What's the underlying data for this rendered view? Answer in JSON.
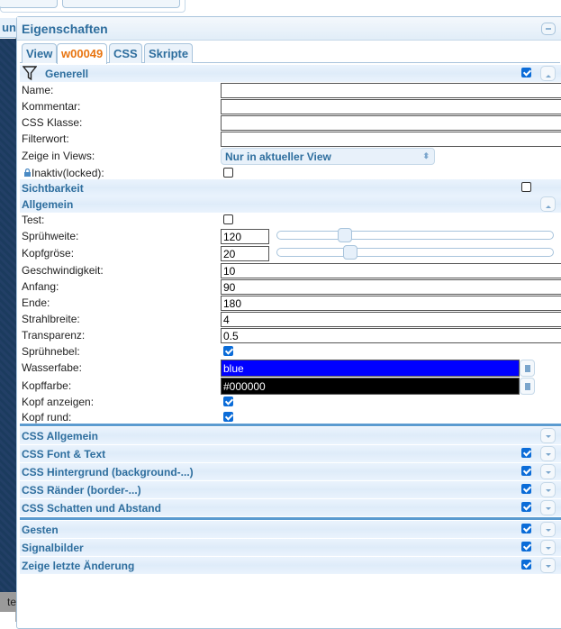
{
  "left": {
    "tab_label": "un",
    "footer_text": "te"
  },
  "panel": {
    "title": "Eigenschaften"
  },
  "tabs": [
    {
      "label": "View"
    },
    {
      "label": "w00049"
    },
    {
      "label": "CSS"
    },
    {
      "label": "Skripte"
    }
  ],
  "generell": {
    "title": "Generell",
    "enabled": true,
    "fields": {
      "name": {
        "label": "Name:",
        "value": ""
      },
      "kommentar": {
        "label": "Kommentar:",
        "value": ""
      },
      "css_klasse": {
        "label": "CSS Klasse:",
        "value": ""
      },
      "filterwort": {
        "label": "Filterwort:",
        "value": ""
      },
      "zeige": {
        "label": "Zeige in Views:",
        "value": "Nur in aktueller View"
      },
      "inaktiv": {
        "label": "Inaktiv(locked):",
        "checked": false
      }
    }
  },
  "sichtbarkeit": {
    "title": "Sichtbarkeit",
    "checked": false
  },
  "allgemein": {
    "title": "Allgemein",
    "test": {
      "label": "Test:",
      "checked": false
    },
    "spruehweite": {
      "label": "Sprühweite:",
      "value": "120",
      "slider_fraction": 0.23
    },
    "kopfgroese": {
      "label": "Kopfgröse:",
      "value": "20",
      "slider_fraction": 0.25
    },
    "geschwindigkeit": {
      "label": "Geschwindigkeit:",
      "value": "10"
    },
    "anfang": {
      "label": "Anfang:",
      "value": "90"
    },
    "ende": {
      "label": "Ende:",
      "value": "180"
    },
    "strahlbreite": {
      "label": "Strahlbreite:",
      "value": "4"
    },
    "transparenz": {
      "label": "Transparenz:",
      "value": "0.5"
    },
    "spruehnebel": {
      "label": "Sprühnebel:",
      "checked": true
    },
    "wasserfabe": {
      "label": "Wasserfabe:",
      "value": "blue",
      "color": "#0000ff"
    },
    "kopffarbe": {
      "label": "Kopffarbe:",
      "value": "#000000",
      "color": "#000000"
    },
    "kopf_anzeigen": {
      "label": "Kopf anzeigen:",
      "checked": true
    },
    "kopf_rund": {
      "label": "Kopf rund:",
      "checked": true
    }
  },
  "css_groups": [
    {
      "title": "CSS Allgemein",
      "checkbox": false
    },
    {
      "title": "CSS Font & Text",
      "checkbox": true
    },
    {
      "title": "CSS Hintergrund (background-...)",
      "checkbox": true
    },
    {
      "title": "CSS Ränder (border-...)",
      "checkbox": true
    },
    {
      "title": "CSS Schatten und Abstand",
      "checkbox": true
    }
  ],
  "other_groups": [
    {
      "title": "Gesten"
    },
    {
      "title": "Signalbilder"
    },
    {
      "title": "Zeige letzte Änderung"
    }
  ],
  "colors": {
    "accent": "#2e6e9e",
    "active_tab": "#e87511"
  }
}
